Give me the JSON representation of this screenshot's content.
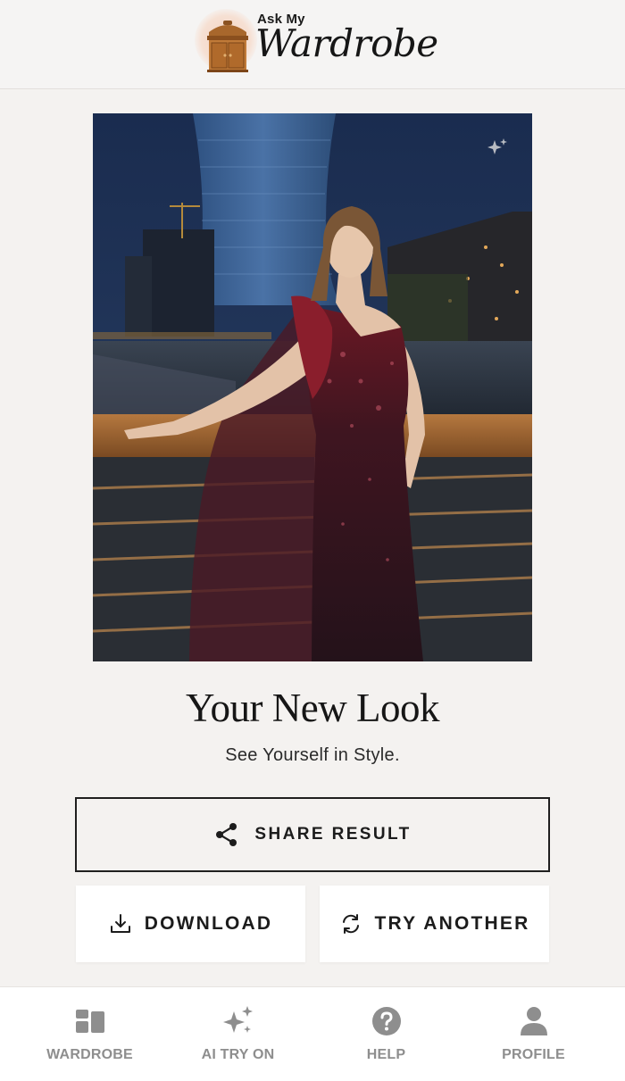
{
  "header": {
    "logo_small": "Ask My",
    "logo_big": "Wardrobe"
  },
  "result": {
    "title": "Your New Look",
    "subtitle": "See Yourself in Style."
  },
  "actions": {
    "share_label": "SHARE RESULT",
    "download_label": "DOWNLOAD",
    "try_another_label": "TRY ANOTHER"
  },
  "nav": {
    "items": [
      {
        "label": "WARDROBE",
        "icon": "wardrobe-icon"
      },
      {
        "label": "AI TRY ON",
        "icon": "sparkles-icon"
      },
      {
        "label": "HELP",
        "icon": "help-icon"
      },
      {
        "label": "PROFILE",
        "icon": "profile-icon"
      }
    ]
  },
  "colors": {
    "background": "#f4f2f0",
    "text": "#1e1e1e",
    "nav_inactive": "#8e8e8e",
    "card": "#ffffff"
  }
}
